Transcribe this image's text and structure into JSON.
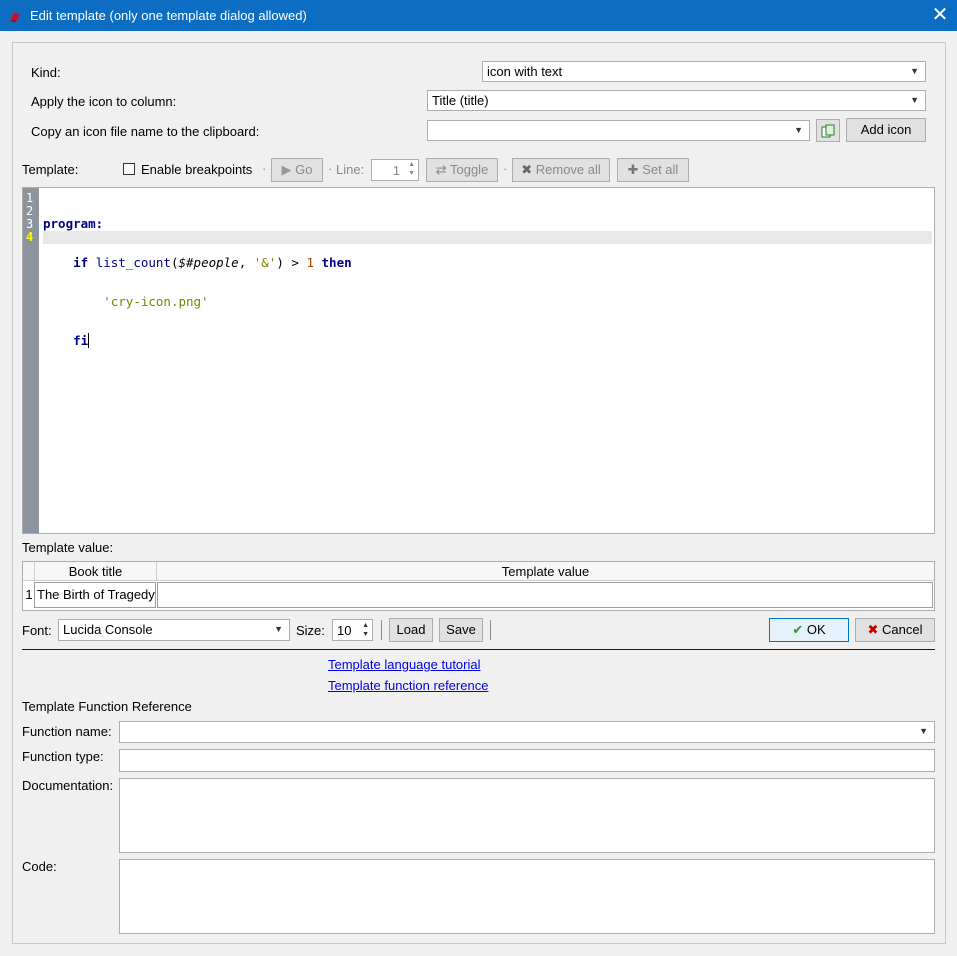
{
  "window": {
    "title": "Edit template (only one template dialog allowed)"
  },
  "kind": {
    "label": "Kind:",
    "value": "icon with text"
  },
  "apply_column": {
    "label": "Apply the icon to column:",
    "value": "Title (title)"
  },
  "copy_icon": {
    "label": "Copy an icon file name to the clipboard:",
    "value": "",
    "add_icon_label": "Add icon"
  },
  "template_toolbar": {
    "template_label": "Template:",
    "enable_breakpoints_label": "Enable breakpoints",
    "go_label": "Go",
    "line_label": "Line:",
    "line_value": "1",
    "toggle_label": "Toggle",
    "remove_all_label": "Remove all",
    "set_all_label": "Set all"
  },
  "editor": {
    "line_numbers": [
      "1",
      "2",
      "3",
      "4"
    ],
    "lines": {
      "l1_kw": "program:",
      "l2_if": "if",
      "l2_fn": "list_count",
      "l2_open": "(",
      "l2_var": "$#people",
      "l2_comma": ", ",
      "l2_str": "'&'",
      "l2_close": ") > ",
      "l2_num": "1",
      "l2_then": "then",
      "l3_str": "'cry-icon.png'",
      "l4_kw": "fi"
    }
  },
  "template_value": {
    "label": "Template value:",
    "columns": [
      "Book title",
      "Template value"
    ],
    "rows": [
      {
        "index": "1",
        "book_title": "The Birth of Tragedy",
        "value": ""
      }
    ]
  },
  "font_bar": {
    "font_label": "Font:",
    "font_value": "Lucida Console",
    "size_label": "Size:",
    "size_value": "10",
    "load_label": "Load",
    "save_label": "Save",
    "ok_label": "OK",
    "cancel_label": "Cancel"
  },
  "links": {
    "tutorial": "Template language tutorial",
    "reference": "Template function reference"
  },
  "function_reference": {
    "heading": "Template Function Reference",
    "function_name_label": "Function name:",
    "function_name_value": "",
    "function_type_label": "Function type:",
    "function_type_value": "",
    "documentation_label": "Documentation:",
    "documentation_value": "",
    "code_label": "Code:",
    "code_value": ""
  },
  "colors": {
    "titlebar": "#0d6dc3",
    "gutter": "#8c959e",
    "keyword": "#00008b",
    "string": "#808000",
    "ok_check": "#2a9d2a",
    "cancel_x": "#c00000"
  }
}
